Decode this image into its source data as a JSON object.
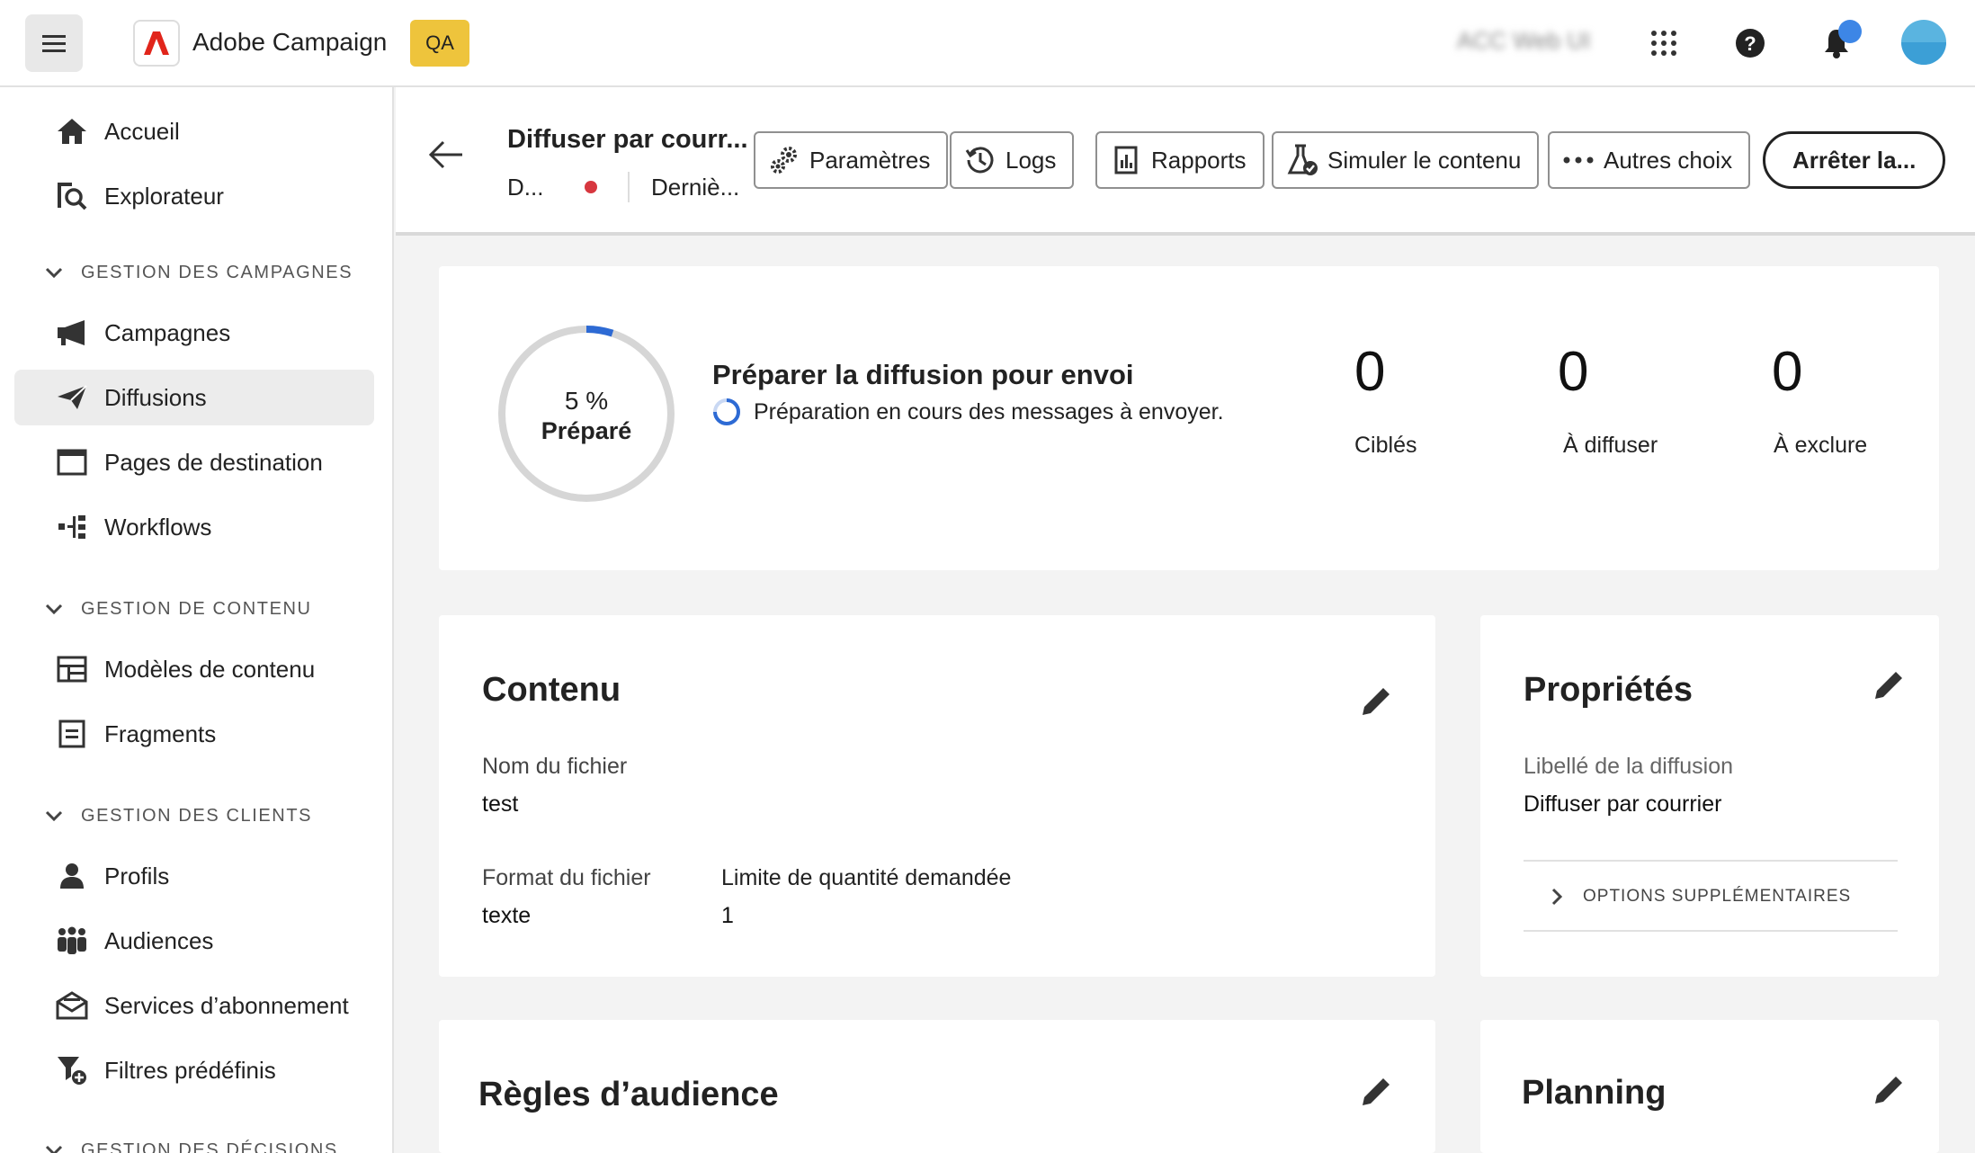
{
  "topbar": {
    "app_name": "Adobe Campaign",
    "env_badge": "QA",
    "org_name": "ACC Web UI",
    "icons": [
      "menu-icon",
      "adobe-logo",
      "app-switcher-icon",
      "help-icon",
      "bell-icon",
      "avatar"
    ]
  },
  "sidebar": {
    "top_items": [
      {
        "label": "Accueil",
        "icon": "home-icon"
      },
      {
        "label": "Explorateur",
        "icon": "explorer-icon"
      }
    ],
    "sections": [
      {
        "title": "GESTION DES CAMPAGNES",
        "items": [
          {
            "label": "Campagnes",
            "icon": "megaphone-icon"
          },
          {
            "label": "Diffusions",
            "icon": "send-icon",
            "active": true
          },
          {
            "label": "Pages de destination",
            "icon": "window-icon"
          },
          {
            "label": "Workflows",
            "icon": "workflow-icon"
          }
        ]
      },
      {
        "title": "GESTION DE CONTENU",
        "items": [
          {
            "label": "Modèles de contenu",
            "icon": "template-icon"
          },
          {
            "label": "Fragments",
            "icon": "fragment-icon"
          }
        ]
      },
      {
        "title": "GESTION DES CLIENTS",
        "items": [
          {
            "label": "Profils",
            "icon": "user-icon"
          },
          {
            "label": "Audiences",
            "icon": "users-icon"
          },
          {
            "label": "Services d’abonnement",
            "icon": "mail-open-icon"
          },
          {
            "label": "Filtres prédéfinis",
            "icon": "filter-add-icon"
          }
        ]
      },
      {
        "title": "GESTION DES DÉCISIONS",
        "items": []
      }
    ]
  },
  "header": {
    "title": "Diffuser par courr...",
    "subtitle_left": "D...",
    "subtitle_right": "Derniè...",
    "buttons": {
      "params": "Paramètres",
      "logs": "Logs",
      "reports": "Rapports",
      "simulate": "Simuler le contenu",
      "more": "Autres choix",
      "stop": "Arrêter la..."
    }
  },
  "progress": {
    "percent_label": "5 %",
    "percent": 5,
    "state": "Préparé",
    "title": "Préparer la diffusion pour envoi",
    "message": "Préparation en cours des messages à envoyer.",
    "accent": "#2d6ad4",
    "stats": [
      {
        "value": "0",
        "label": "Ciblés"
      },
      {
        "value": "0",
        "label": "À diffuser"
      },
      {
        "value": "0",
        "label": "À exclure"
      }
    ]
  },
  "content_card": {
    "title": "Contenu",
    "file_name_label": "Nom du fichier",
    "file_name": "test",
    "file_format_label": "Format du fichier",
    "file_format": "texte",
    "quantity_label": "Limite de quantité demandée",
    "quantity": "1"
  },
  "properties_card": {
    "title": "Propriétés",
    "label_label": "Libellé de la diffusion",
    "label_value": "Diffuser par courrier",
    "more_options": "OPTIONS SUPPLÉMENTAIRES"
  },
  "audience_card": {
    "title": "Règles d’audience"
  },
  "planning_card": {
    "title": "Planning"
  }
}
